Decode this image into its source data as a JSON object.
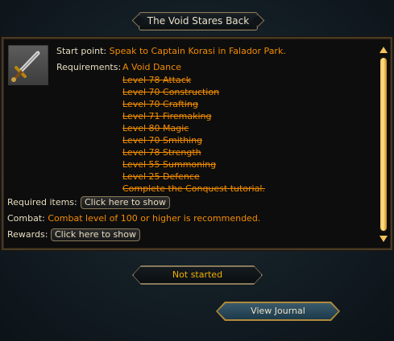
{
  "quest": {
    "title": "The Void Stares Back",
    "start_label": "Start point:",
    "start_value": "Speak to Captain Korasi in Falador Park.",
    "requirements_label": "Requirements:",
    "requirements_first": "A Void Dance",
    "requirements": [
      "Level 78 Attack",
      "Level 70 Construction",
      "Level 70 Crafting",
      "Level 71 Firemaking",
      "Level 80 Magic",
      "Level 70 Smithing",
      "Level 78 Strength",
      "Level 55 Summoning",
      "Level 25 Defence",
      "Complete the Conquest tutorial."
    ],
    "required_items_label": "Required items:",
    "required_items_button": "Click here to show",
    "combat_label": "Combat:",
    "combat_value": "Combat level of 100 or higher is recommended.",
    "rewards_label": "Rewards:",
    "rewards_button": "Click here to show",
    "status": "Not started",
    "journal_button": "View Journal"
  },
  "colors": {
    "label": "#e6dcc0",
    "value": "#f28c00",
    "status": "#f0b000",
    "frame": "#8a7a5a"
  },
  "icons": {
    "quest_icon": "sword-icon",
    "scroll_up": "arrow-up-icon",
    "scroll_down": "arrow-down-icon"
  }
}
